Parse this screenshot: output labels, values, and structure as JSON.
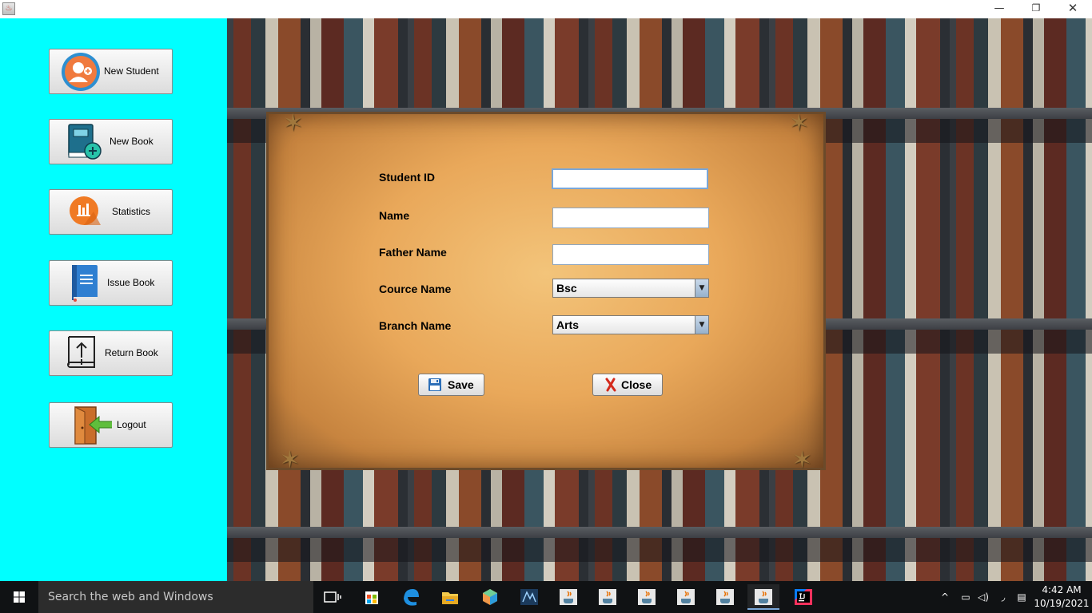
{
  "window": {
    "app_icon": "java-cup-icon",
    "minimize_glyph": "—",
    "maximize_glyph": "❐",
    "close_glyph": "✕"
  },
  "sidebar": {
    "background": "#00ffff",
    "items": [
      {
        "label": "New Student",
        "icon": "add-user-icon"
      },
      {
        "label": "New Book",
        "icon": "add-book-icon"
      },
      {
        "label": "Statistics",
        "icon": "bar-chart-icon"
      },
      {
        "label": "Issue Book",
        "icon": "book-icon"
      },
      {
        "label": "Return Book",
        "icon": "return-book-icon"
      },
      {
        "label": "Logout",
        "icon": "logout-door-icon"
      }
    ]
  },
  "form": {
    "fields": [
      {
        "label": "Student ID",
        "value": ""
      },
      {
        "label": "Name",
        "value": ""
      },
      {
        "label": "Father Name",
        "value": ""
      }
    ],
    "course": {
      "label": "Cource Name",
      "selected": "Bsc"
    },
    "branch": {
      "label": "Branch Name",
      "selected": "Arts"
    },
    "save_label": "Save",
    "close_label": "Close"
  },
  "taskbar": {
    "search_placeholder": "Search the web and Windows",
    "time": "4:42 AM",
    "date": "10/19/2021"
  }
}
